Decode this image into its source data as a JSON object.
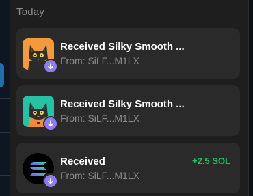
{
  "section": {
    "title": "Today"
  },
  "colors": {
    "panel": "#1e1e1e",
    "card": "#2a2a2a",
    "accent": "#8e7cf0",
    "positive": "#21c45d"
  },
  "items": [
    {
      "title": "Received Silky Smooth ...",
      "subtitle": "From: SiLF...M1LX",
      "amount": "",
      "avatar": "cat-nft-orange",
      "badge": "arrow-down-icon"
    },
    {
      "title": "Received Silky Smooth ...",
      "subtitle": "From: SiLF...M1LX",
      "amount": "",
      "avatar": "cat-nft-teal",
      "badge": "arrow-down-icon"
    },
    {
      "title": "Received",
      "subtitle": "From: SiLF...M1LX",
      "amount": "+2.5 SOL",
      "avatar": "solana-logo",
      "badge": "arrow-down-icon"
    }
  ]
}
